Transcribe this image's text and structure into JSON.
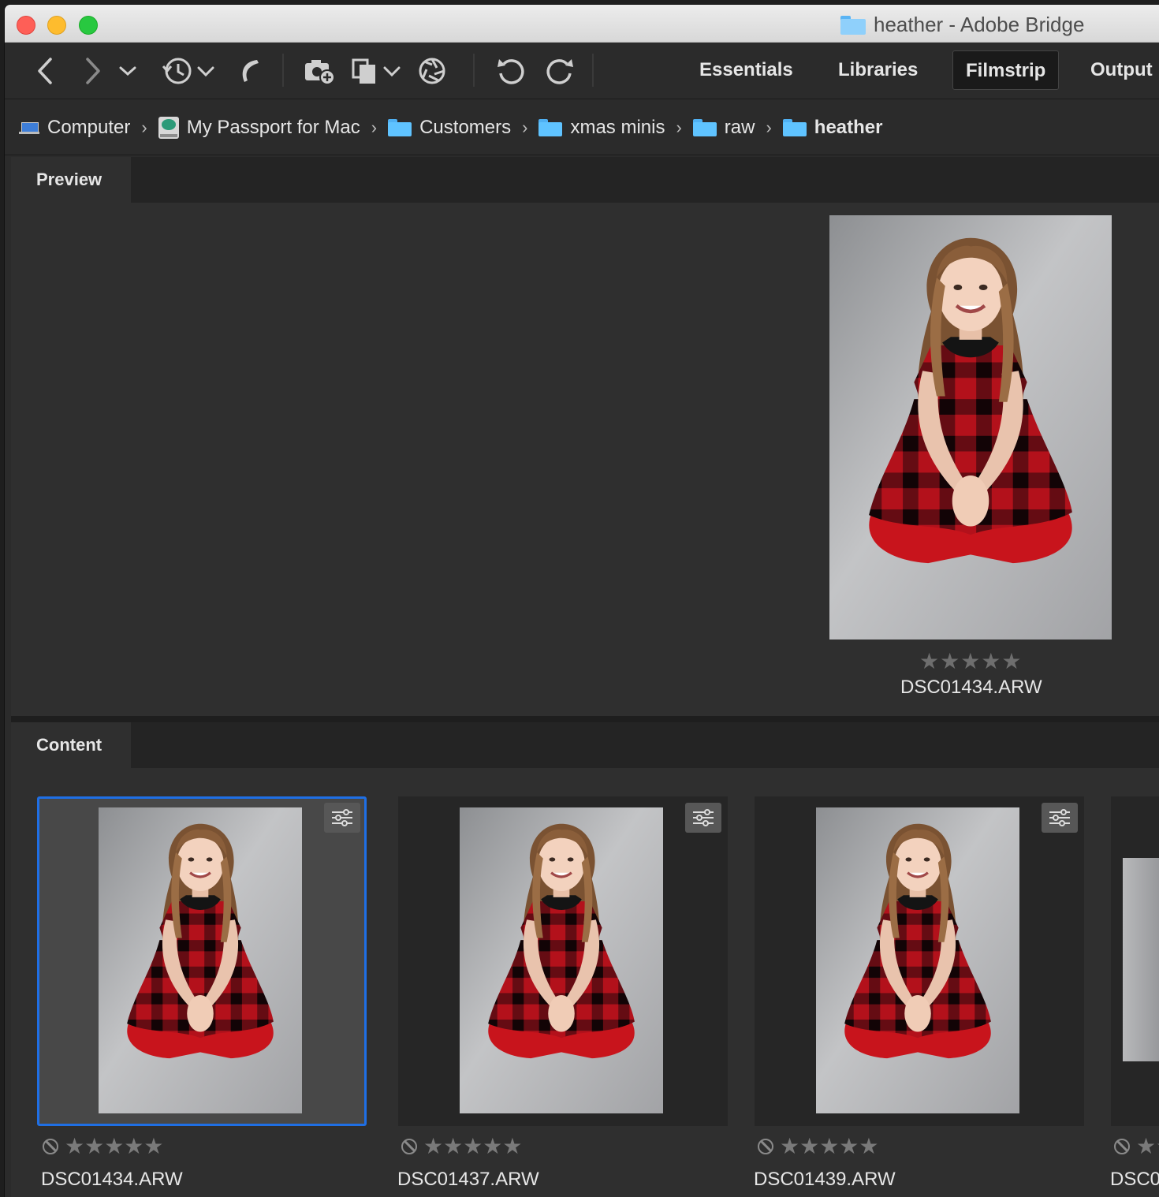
{
  "window": {
    "title": "heather - Adobe Bridge"
  },
  "toolbar": {
    "icons": [
      "back-arrow-icon",
      "forward-arrow-icon",
      "chevron-down-icon",
      "recent-history-icon",
      "boomerang-icon",
      "camera-import-icon",
      "refine-copy-icon",
      "camera-raw-icon",
      "rotate-left-icon",
      "rotate-right-icon"
    ],
    "workspaces": [
      {
        "label": "Essentials",
        "active": false
      },
      {
        "label": "Libraries",
        "active": false
      },
      {
        "label": "Filmstrip",
        "active": true
      },
      {
        "label": "Output",
        "active": false
      }
    ]
  },
  "path": {
    "crumbs": [
      {
        "label": "Computer",
        "icon": "computer-icon"
      },
      {
        "label": "My Passport for Mac",
        "icon": "drive-icon"
      },
      {
        "label": "Customers",
        "icon": "folder-icon"
      },
      {
        "label": "xmas minis",
        "icon": "folder-icon"
      },
      {
        "label": "raw",
        "icon": "folder-icon"
      },
      {
        "label": "heather",
        "icon": "folder-icon"
      }
    ]
  },
  "preview": {
    "tab_label": "Preview",
    "stars": "★★★★★",
    "filename": "DSC01434.ARW"
  },
  "content": {
    "tab_label": "Content",
    "items": [
      {
        "filename": "DSC01434.ARW",
        "stars": "★★★★★",
        "selected": true
      },
      {
        "filename": "DSC01437.ARW",
        "stars": "★★★★★",
        "selected": false
      },
      {
        "filename": "DSC01439.ARW",
        "stars": "★★★★★",
        "selected": false
      },
      {
        "filename": "DSC0",
        "stars": "★★",
        "selected": false
      }
    ]
  },
  "colors": {
    "accent_selection": "#1f6fe5",
    "panel_bg": "#2f2f2f",
    "dress_red": "#b3111b"
  }
}
